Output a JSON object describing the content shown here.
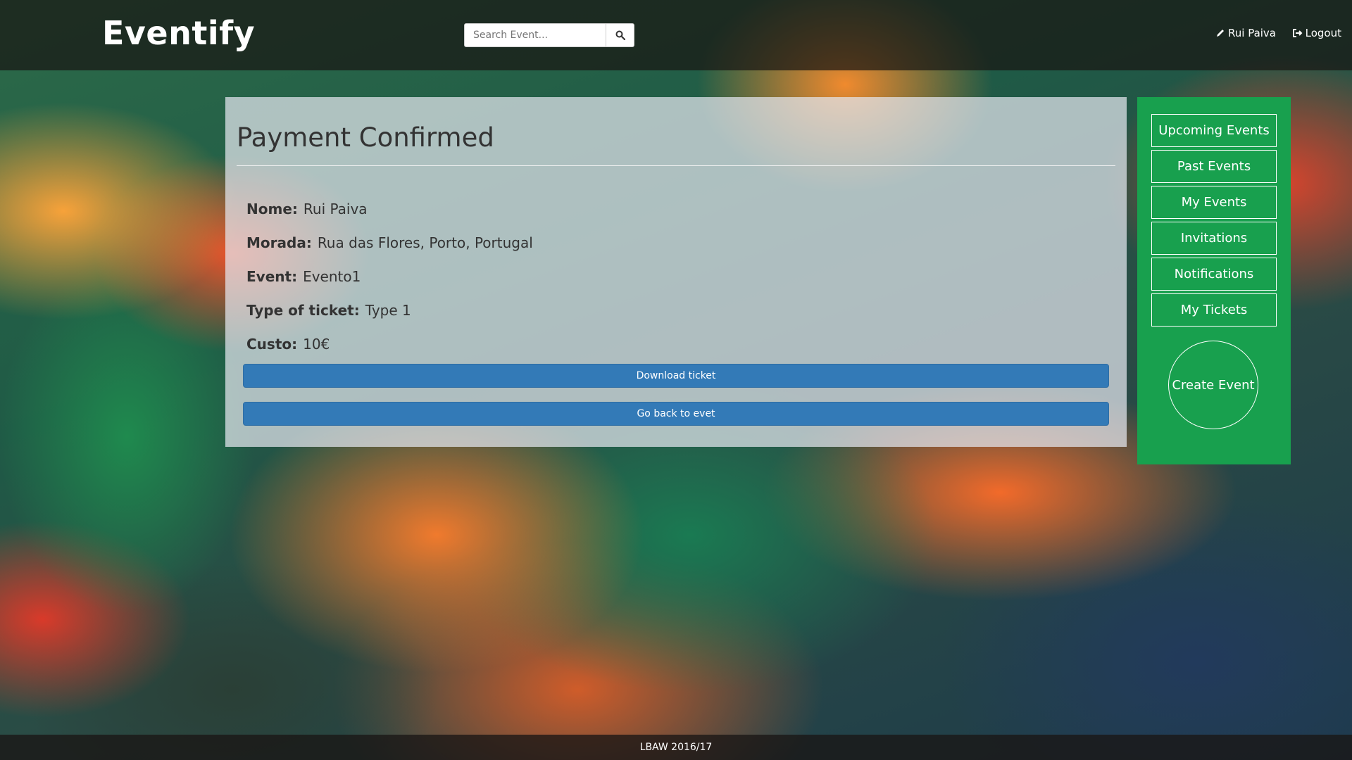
{
  "brand": {
    "name": "Eventify"
  },
  "search": {
    "placeholder": "Search Event...",
    "button_icon": "search-icon"
  },
  "nav": {
    "user_label": "Rui Paiva",
    "user_icon": "pencil-icon",
    "logout_label": "Logout",
    "logout_icon": "logout-icon"
  },
  "main": {
    "title": "Payment Confirmed",
    "fields": [
      {
        "label": "Nome:",
        "value": "Rui Paiva"
      },
      {
        "label": "Morada:",
        "value": "Rua das Flores, Porto, Portugal"
      },
      {
        "label": "Event:",
        "value": "Evento1"
      },
      {
        "label": "Type of ticket:",
        "value": "Type 1"
      },
      {
        "label": "Custo:",
        "value": "10€"
      }
    ],
    "download_label": "Download ticket",
    "back_label": "Go back to evet"
  },
  "sidebar": {
    "items": [
      {
        "label": "Upcoming Events"
      },
      {
        "label": "Past Events"
      },
      {
        "label": "My Events"
      },
      {
        "label": "Invitations"
      },
      {
        "label": "Notifications"
      },
      {
        "label": "My Tickets"
      }
    ],
    "create_label": "Create Event"
  },
  "footer": {
    "text": "LBAW 2016/17"
  },
  "colors": {
    "sidebar_bg": "#18a04e",
    "primary_button": "#337ab7",
    "navbar_bg": "#19161480"
  }
}
